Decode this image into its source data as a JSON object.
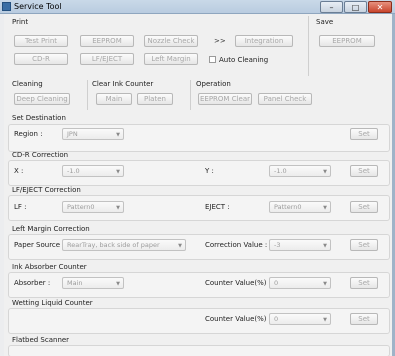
{
  "window": {
    "title": "Service Tool",
    "minimize": "–",
    "maximize": "□",
    "close": "✕"
  },
  "print": {
    "label": "Print",
    "buttons": [
      "Test Print",
      "EEPROM",
      "Nozzle Check",
      "Integration",
      "CD-R",
      "LF/EJECT",
      "Left Margin"
    ],
    "chevron": ">>",
    "auto_cleaning": "Auto Cleaning"
  },
  "save": {
    "label": "Save",
    "eeprom": "EEPROM"
  },
  "cleaning": {
    "label": "Cleaning",
    "deep": "Deep Cleaning"
  },
  "ink_counter": {
    "label": "Clear Ink Counter",
    "main": "Main",
    "platen": "Platen"
  },
  "operation": {
    "label": "Operation",
    "eeprom_clear": "EEPROM Clear",
    "panel_check": "Panel Check"
  },
  "set_destination": {
    "label": "Set Destination",
    "region_label": "Region :",
    "region_value": "JPN",
    "set": "Set"
  },
  "cdr_correction": {
    "label": "CD-R Correction",
    "x_label": "X :",
    "x_value": "-1.0",
    "y_label": "Y :",
    "y_value": "-1.0",
    "set": "Set"
  },
  "lf_eject": {
    "label": "LF/EJECT Correction",
    "lf_label": "LF :",
    "lf_value": "Pattern0",
    "eject_label": "EJECT :",
    "eject_value": "Pattern0",
    "set": "Set"
  },
  "left_margin": {
    "label": "Left Margin Correction",
    "paper_label": "Paper Source :",
    "paper_value": "RearTray, back side of paper",
    "corr_label": "Correction Value :",
    "corr_value": "-3",
    "set": "Set"
  },
  "ink_absorber": {
    "label": "Ink Absorber Counter",
    "absorber_label": "Absorber :",
    "absorber_value": "Main",
    "counter_label": "Counter Value(%) :",
    "counter_value": "0",
    "set": "Set"
  },
  "wetting": {
    "label": "Wetting Liquid Counter",
    "counter_label": "Counter Value(%) :",
    "counter_value": "0",
    "set": "Set"
  },
  "flatbed": {
    "label": "Flatbed Scanner"
  }
}
